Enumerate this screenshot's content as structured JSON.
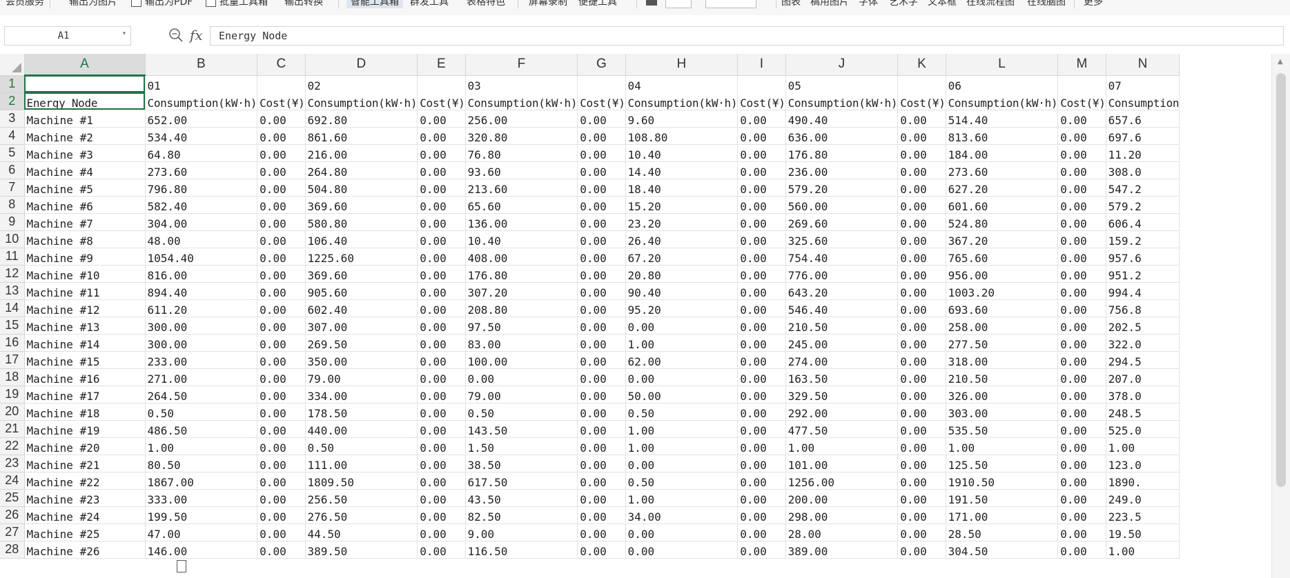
{
  "ribbon": {
    "items": [
      "会员服务",
      "输出为图片",
      "输出为PDF",
      "批量工具箱",
      "输出转换",
      "智能工具箱",
      "群发工具",
      "表格特色",
      "屏幕录制",
      "便捷工具",
      "图表",
      "稿用图片",
      "字体",
      "艺术字",
      "文本框",
      "在线流程图",
      "在线脑图",
      "更多"
    ],
    "active_item": "智能工具箱"
  },
  "formula_bar": {
    "name_box": "A1",
    "fx_label": "fx",
    "content": "Energy Node"
  },
  "columns": [
    "A",
    "B",
    "C",
    "D",
    "E",
    "F",
    "G",
    "H",
    "I",
    "J",
    "K",
    "L",
    "M",
    "N"
  ],
  "selected_cell": "A1",
  "header_row1": [
    "",
    "01",
    "",
    "02",
    "",
    "03",
    "",
    "04",
    "",
    "05",
    "",
    "06",
    "",
    "07"
  ],
  "header_row2": [
    "Energy Node",
    "Consumption(kW·h)",
    "Cost(¥)",
    "Consumption(kW·h)",
    "Cost(¥)",
    "Consumption(kW·h)",
    "Cost(¥)",
    "Consumption(kW·h)",
    "Cost(¥)",
    "Consumption(kW·h)",
    "Cost(¥)",
    "Consumption(kW·h)",
    "Cost(¥)",
    "Consumption"
  ],
  "rows": [
    [
      "Machine #1",
      "652.00",
      "0.00",
      "692.80",
      "0.00",
      "256.00",
      "0.00",
      "9.60",
      "0.00",
      "490.40",
      "0.00",
      "514.40",
      "0.00",
      "657.6"
    ],
    [
      "Machine #2",
      "534.40",
      "0.00",
      "861.60",
      "0.00",
      "320.80",
      "0.00",
      "108.80",
      "0.00",
      "636.00",
      "0.00",
      "813.60",
      "0.00",
      "697.6"
    ],
    [
      "Machine #3",
      "64.80",
      "0.00",
      "216.00",
      "0.00",
      "76.80",
      "0.00",
      "10.40",
      "0.00",
      "176.80",
      "0.00",
      "184.00",
      "0.00",
      "11.20"
    ],
    [
      "Machine #4",
      "273.60",
      "0.00",
      "264.80",
      "0.00",
      "93.60",
      "0.00",
      "14.40",
      "0.00",
      "236.00",
      "0.00",
      "273.60",
      "0.00",
      "308.0"
    ],
    [
      "Machine #5",
      "796.80",
      "0.00",
      "504.80",
      "0.00",
      "213.60",
      "0.00",
      "18.40",
      "0.00",
      "579.20",
      "0.00",
      "627.20",
      "0.00",
      "547.2"
    ],
    [
      "Machine #6",
      "582.40",
      "0.00",
      "369.60",
      "0.00",
      "65.60",
      "0.00",
      "15.20",
      "0.00",
      "560.00",
      "0.00",
      "601.60",
      "0.00",
      "579.2"
    ],
    [
      "Machine #7",
      "304.00",
      "0.00",
      "580.80",
      "0.00",
      "136.00",
      "0.00",
      "23.20",
      "0.00",
      "269.60",
      "0.00",
      "524.80",
      "0.00",
      "606.4"
    ],
    [
      "Machine #8",
      "48.00",
      "0.00",
      "106.40",
      "0.00",
      "10.40",
      "0.00",
      "26.40",
      "0.00",
      "325.60",
      "0.00",
      "367.20",
      "0.00",
      "159.2"
    ],
    [
      "Machine #9",
      "1054.40",
      "0.00",
      "1225.60",
      "0.00",
      "408.00",
      "0.00",
      "67.20",
      "0.00",
      "754.40",
      "0.00",
      "765.60",
      "0.00",
      "957.6"
    ],
    [
      "Machine #10",
      "816.00",
      "0.00",
      "369.60",
      "0.00",
      "176.80",
      "0.00",
      "20.80",
      "0.00",
      "776.00",
      "0.00",
      "956.00",
      "0.00",
      "951.2"
    ],
    [
      "Machine #11",
      "894.40",
      "0.00",
      "905.60",
      "0.00",
      "307.20",
      "0.00",
      "90.40",
      "0.00",
      "643.20",
      "0.00",
      "1003.20",
      "0.00",
      "994.4"
    ],
    [
      "Machine #12",
      "611.20",
      "0.00",
      "602.40",
      "0.00",
      "208.80",
      "0.00",
      "95.20",
      "0.00",
      "546.40",
      "0.00",
      "693.60",
      "0.00",
      "756.8"
    ],
    [
      "Machine #13",
      "300.00",
      "0.00",
      "307.00",
      "0.00",
      "97.50",
      "0.00",
      "0.00",
      "0.00",
      "210.50",
      "0.00",
      "258.00",
      "0.00",
      "202.5"
    ],
    [
      "Machine #14",
      "300.00",
      "0.00",
      "269.50",
      "0.00",
      "83.00",
      "0.00",
      "1.00",
      "0.00",
      "245.00",
      "0.00",
      "277.50",
      "0.00",
      "322.0"
    ],
    [
      "Machine #15",
      "233.00",
      "0.00",
      "350.00",
      "0.00",
      "100.00",
      "0.00",
      "62.00",
      "0.00",
      "274.00",
      "0.00",
      "318.00",
      "0.00",
      "294.5"
    ],
    [
      "Machine #16",
      "271.00",
      "0.00",
      "79.00",
      "0.00",
      "0.00",
      "0.00",
      "0.00",
      "0.00",
      "163.50",
      "0.00",
      "210.50",
      "0.00",
      "207.0"
    ],
    [
      "Machine #17",
      "264.50",
      "0.00",
      "334.00",
      "0.00",
      "79.00",
      "0.00",
      "50.00",
      "0.00",
      "329.50",
      "0.00",
      "326.00",
      "0.00",
      "378.0"
    ],
    [
      "Machine #18",
      "0.50",
      "0.00",
      "178.50",
      "0.00",
      "0.50",
      "0.00",
      "0.50",
      "0.00",
      "292.00",
      "0.00",
      "303.00",
      "0.00",
      "248.5"
    ],
    [
      "Machine #19",
      "486.50",
      "0.00",
      "440.00",
      "0.00",
      "143.50",
      "0.00",
      "1.00",
      "0.00",
      "477.50",
      "0.00",
      "535.50",
      "0.00",
      "525.0"
    ],
    [
      "Machine #20",
      "1.00",
      "0.00",
      "0.50",
      "0.00",
      "1.50",
      "0.00",
      "1.00",
      "0.00",
      "1.00",
      "0.00",
      "1.00",
      "0.00",
      "1.00"
    ],
    [
      "Machine #21",
      "80.50",
      "0.00",
      "111.00",
      "0.00",
      "38.50",
      "0.00",
      "0.00",
      "0.00",
      "101.00",
      "0.00",
      "125.50",
      "0.00",
      "123.0"
    ],
    [
      "Machine #22",
      "1867.00",
      "0.00",
      "1809.50",
      "0.00",
      "617.50",
      "0.00",
      "0.50",
      "0.00",
      "1256.00",
      "0.00",
      "1910.50",
      "0.00",
      "1890."
    ],
    [
      "Machine #23",
      "333.00",
      "0.00",
      "256.50",
      "0.00",
      "43.50",
      "0.00",
      "1.00",
      "0.00",
      "200.00",
      "0.00",
      "191.50",
      "0.00",
      "249.0"
    ],
    [
      "Machine #24",
      "199.50",
      "0.00",
      "276.50",
      "0.00",
      "82.50",
      "0.00",
      "34.00",
      "0.00",
      "298.00",
      "0.00",
      "171.00",
      "0.00",
      "223.5"
    ],
    [
      "Machine #25",
      "47.00",
      "0.00",
      "44.50",
      "0.00",
      "9.00",
      "0.00",
      "0.00",
      "0.00",
      "28.00",
      "0.00",
      "28.50",
      "0.00",
      "19.50"
    ],
    [
      "Machine #26",
      "146.00",
      "0.00",
      "389.50",
      "0.00",
      "116.50",
      "0.00",
      "0.00",
      "0.00",
      "389.00",
      "0.00",
      "304.50",
      "0.00",
      "1.00"
    ]
  ]
}
